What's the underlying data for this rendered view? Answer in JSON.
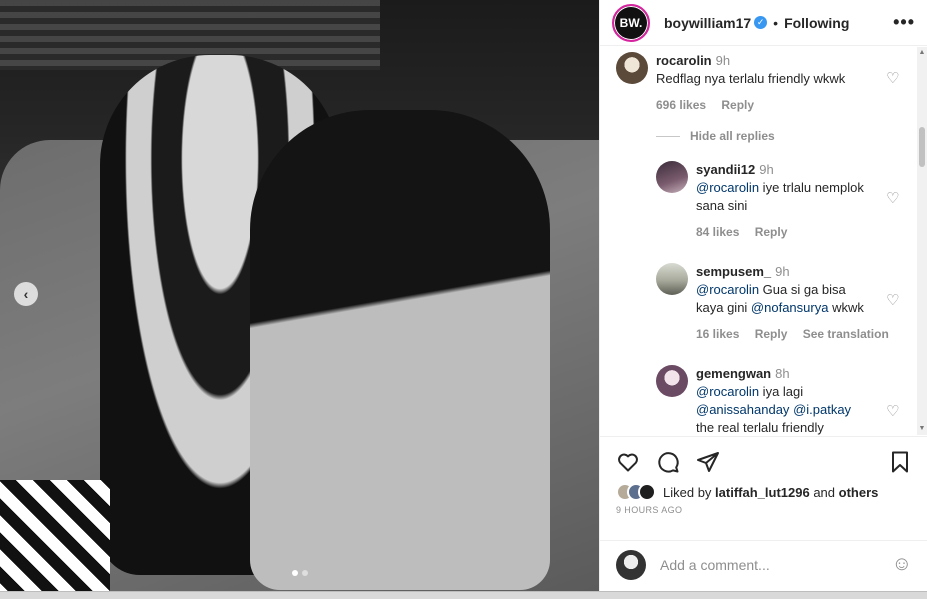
{
  "post": {
    "carousel_prev": "‹",
    "carousel_dots": 2
  },
  "header": {
    "avatar_text": "BW.",
    "username": "boywilliam17",
    "verified_mark": "✓",
    "separator": "•",
    "follow_status": "Following",
    "more_icon": "•••"
  },
  "comments": [
    {
      "user": "rocarolin",
      "time": "9h",
      "text": "Redflag nya terlalu friendly wkwk",
      "likes": "696 likes",
      "reply": "Reply"
    }
  ],
  "hide_replies": "Hide all replies",
  "replies": [
    {
      "user": "syandii12",
      "time": "9h",
      "mention": "@rocarolin",
      "text_line1": " iye trlalu nemplok",
      "text_line2": "sana sini",
      "likes": "84 likes",
      "reply": "Reply"
    },
    {
      "user": "sempusem_",
      "time": "9h",
      "mention": "@rocarolin",
      "text_line1": " Gua si ga bisa",
      "text_line2a": "kaya gini ",
      "mention2": "@nofansurya",
      "text_line2b": " wkwk",
      "likes": "16 likes",
      "reply": "Reply",
      "translate": "See translation"
    },
    {
      "user": "gemengwan",
      "time": "8h",
      "mention": "@rocarolin",
      "text_line1": " iya lagi",
      "mention2": "@anissahanday",
      "mention3": "@i.patkay",
      "text_line3": "the real terlalu friendly"
    }
  ],
  "likes_section": {
    "prefix": "Liked by ",
    "user": "latiffah_lut1296",
    "connector": " and ",
    "others": "others",
    "time_ago": "9 HOURS AGO"
  },
  "add_comment": {
    "placeholder": "Add a comment...",
    "emoji_icon": "☺"
  },
  "icons": {
    "heart_outline": "♡"
  },
  "colors": {
    "link": "#00376b",
    "muted": "#8e8e8e",
    "verified": "#3897f0"
  }
}
